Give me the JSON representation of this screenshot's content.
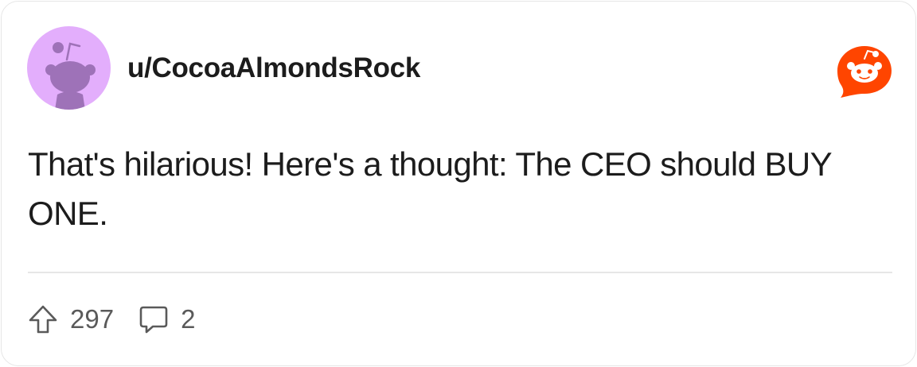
{
  "post": {
    "username": "u/CocoaAlmondsRock",
    "text": "That's hilarious! Here's a thought: The CEO should BUY ONE."
  },
  "actions": {
    "upvotes": "297",
    "comments": "2"
  },
  "icons": {
    "avatar": "snoo-avatar-icon",
    "brand": "reddit-logo-icon",
    "upvote": "upvote-arrow-icon",
    "comment": "comment-bubble-icon"
  },
  "colors": {
    "avatar_background": "#e3aefc",
    "avatar_snoo": "#9e72b8",
    "brand_orange": "#ff4500",
    "text": "#1c1c1c",
    "muted": "#5a5a5a"
  }
}
